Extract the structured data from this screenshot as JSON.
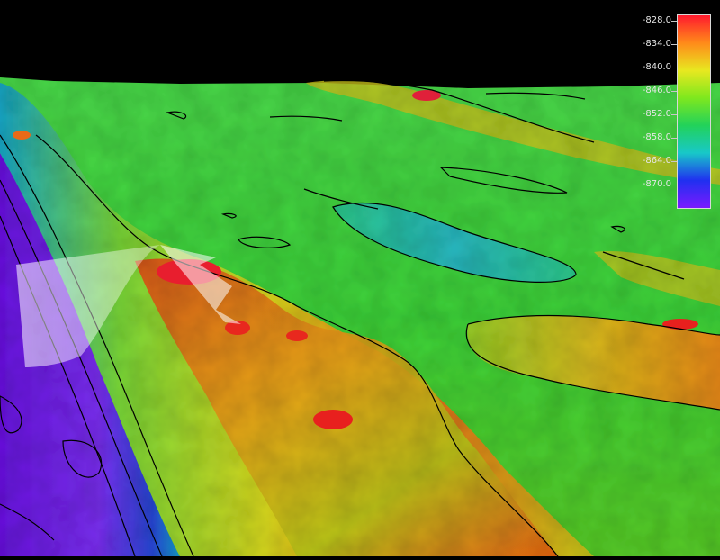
{
  "scene": {
    "description_icon": "bathymetry-3d-icon",
    "colors": {
      "sky": "#000000",
      "deep": "#7a1ff0",
      "mid": "#3ad23a",
      "shallow": "#e81e1e"
    }
  },
  "colorbar": {
    "labels": [
      "-828.0",
      "-834.0",
      "-840.0",
      "-846.0",
      "-852.0",
      "-858.0",
      "-864.0",
      "-870.0"
    ],
    "gradient": [
      "#ff1a2e",
      "#ff8a1a",
      "#e8e820",
      "#7ee81e",
      "#22d25a",
      "#18c8c8",
      "#2030f0",
      "#7a1aff"
    ]
  }
}
